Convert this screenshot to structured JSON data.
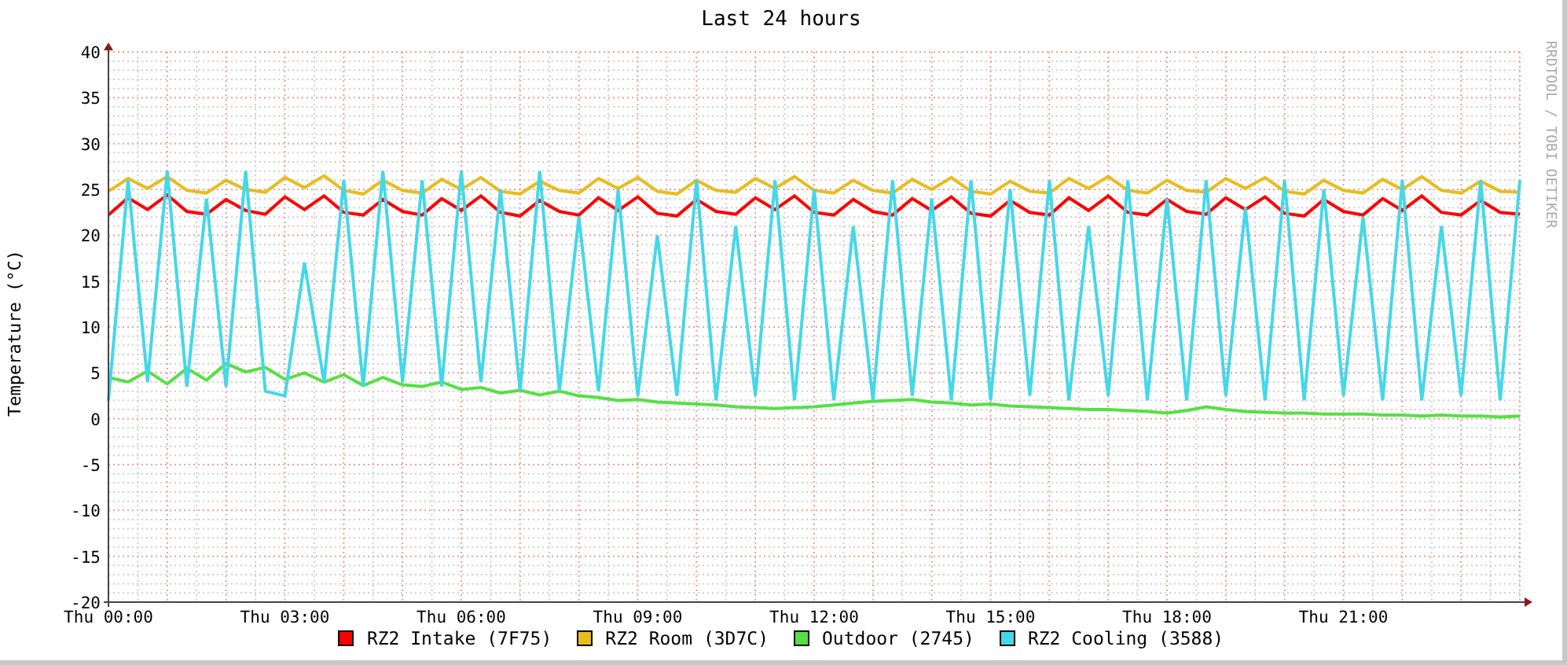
{
  "graph": {
    "credit": "RRDTOOL / TOBI OETIKER",
    "chart_data": {
      "type": "line",
      "title": "Last 24 hours",
      "ylabel": "Temperature (°C)",
      "categories": [
        "Thu 00:00",
        null,
        null,
        null,
        null,
        null,
        null,
        null,
        null,
        "Thu 03:00",
        null,
        null,
        null,
        null,
        null,
        null,
        null,
        null,
        "Thu 06:00",
        null,
        null,
        null,
        null,
        null,
        null,
        null,
        null,
        "Thu 09:00",
        null,
        null,
        null,
        null,
        null,
        null,
        null,
        null,
        "Thu 12:00",
        null,
        null,
        null,
        null,
        null,
        null,
        null,
        null,
        "Thu 15:00",
        null,
        null,
        null,
        null,
        null,
        null,
        null,
        null,
        "Thu 18:00",
        null,
        null,
        null,
        null,
        null,
        null,
        null,
        null,
        "Thu 21:00",
        null,
        null,
        null,
        null,
        null,
        null,
        null,
        null,
        null
      ],
      "grid": true,
      "ylim": [
        -20,
        40
      ],
      "yticks": [
        -20,
        -15,
        -10,
        -5,
        0,
        5,
        10,
        15,
        20,
        25,
        30,
        35,
        40
      ],
      "series": [
        {
          "name": "RZ2 Intake (7F75)",
          "color": "#ff0000",
          "values": [
            22.2,
            24.1,
            22.8,
            24.4,
            22.6,
            22.3,
            23.9,
            22.7,
            22.3,
            24.2,
            22.8,
            24.3,
            22.5,
            22.2,
            23.9,
            22.6,
            22.2,
            24.0,
            22.7,
            24.3,
            22.5,
            22.1,
            23.8,
            22.6,
            22.2,
            24.1,
            22.7,
            24.2,
            22.4,
            22.1,
            23.9,
            22.6,
            22.3,
            24.1,
            22.8,
            24.3,
            22.5,
            22.2,
            23.9,
            22.6,
            22.2,
            24.0,
            22.7,
            24.2,
            22.4,
            22.1,
            23.8,
            22.5,
            22.2,
            24.1,
            22.7,
            24.3,
            22.5,
            22.2,
            23.9,
            22.6,
            22.3,
            24.1,
            22.8,
            24.2,
            22.4,
            22.1,
            23.9,
            22.6,
            22.2,
            24.0,
            22.7,
            24.3,
            22.5,
            22.2,
            23.8,
            22.5,
            22.3
          ]
        },
        {
          "name": "RZ2 Room (3D7C)",
          "color": "#e8bc1c",
          "values": [
            24.8,
            26.2,
            25.1,
            26.4,
            24.9,
            24.6,
            26.0,
            25.0,
            24.7,
            26.3,
            25.2,
            26.5,
            24.9,
            24.5,
            26.0,
            24.9,
            24.6,
            26.1,
            25.0,
            26.3,
            24.8,
            24.5,
            25.9,
            24.9,
            24.6,
            26.2,
            25.1,
            26.3,
            24.8,
            24.5,
            26.0,
            24.9,
            24.7,
            26.2,
            25.1,
            26.4,
            24.9,
            24.6,
            26.0,
            24.9,
            24.6,
            26.1,
            25.0,
            26.3,
            24.8,
            24.5,
            25.9,
            24.8,
            24.6,
            26.2,
            25.1,
            26.4,
            24.9,
            24.6,
            26.0,
            24.9,
            24.7,
            26.2,
            25.1,
            26.3,
            24.8,
            24.5,
            26.0,
            24.9,
            24.6,
            26.1,
            25.0,
            26.4,
            24.9,
            24.6,
            25.9,
            24.8,
            24.7
          ]
        },
        {
          "name": "Outdoor (2745)",
          "color": "#55e044",
          "values": [
            4.5,
            4.0,
            5.2,
            3.8,
            5.5,
            4.2,
            6.0,
            5.1,
            5.6,
            4.3,
            5.0,
            4.0,
            4.8,
            3.6,
            4.5,
            3.7,
            3.5,
            4.0,
            3.2,
            3.4,
            2.8,
            3.1,
            2.6,
            3.0,
            2.5,
            2.3,
            2.0,
            2.1,
            1.8,
            1.7,
            1.6,
            1.5,
            1.3,
            1.2,
            1.1,
            1.2,
            1.3,
            1.5,
            1.7,
            1.9,
            2.0,
            2.1,
            1.8,
            1.7,
            1.5,
            1.6,
            1.4,
            1.3,
            1.2,
            1.1,
            1.0,
            1.0,
            0.9,
            0.8,
            0.6,
            0.9,
            1.3,
            1.0,
            0.8,
            0.7,
            0.6,
            0.6,
            0.5,
            0.5,
            0.5,
            0.4,
            0.4,
            0.3,
            0.4,
            0.3,
            0.3,
            0.2,
            0.3
          ]
        },
        {
          "name": "RZ2 Cooling (3588)",
          "color": "#44d8e8",
          "values": [
            2,
            26,
            4,
            27,
            3.5,
            24,
            3.5,
            27,
            3,
            2.5,
            17,
            4,
            26,
            3.5,
            27,
            4,
            26,
            3.5,
            27,
            4,
            25,
            3,
            27,
            3,
            22,
            3,
            25,
            2.5,
            20,
            2.5,
            26,
            2,
            21,
            2.5,
            26,
            2,
            25,
            2,
            21,
            2,
            26,
            2.5,
            24,
            2,
            26,
            2,
            25,
            2.5,
            26,
            2,
            21,
            2.5,
            26,
            2,
            24,
            2,
            26,
            2.5,
            23,
            2,
            26,
            2,
            25,
            2.5,
            22,
            2,
            26,
            2,
            21,
            2.5,
            26,
            2,
            26
          ]
        }
      ]
    }
  }
}
